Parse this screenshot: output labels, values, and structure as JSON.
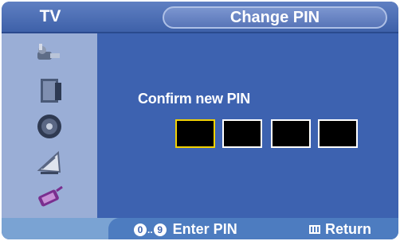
{
  "header": {
    "section_label": "TV",
    "title": "Change PIN"
  },
  "sidebar": {
    "icons": [
      "input-plug-icon",
      "picture-panel-icon",
      "speaker-icon",
      "satellite-dish-icon",
      "connector-icon"
    ]
  },
  "main": {
    "prompt": "Confirm new PIN",
    "pin_digits": 4,
    "active_digit": 1
  },
  "footer": {
    "key_from": "0",
    "key_to": "9",
    "enter_label": "Enter PIN",
    "return_label": "Return"
  },
  "colors": {
    "background": "#3d62b0",
    "sidebar": "#9aaed6",
    "active_box_border": "#f2d200"
  }
}
